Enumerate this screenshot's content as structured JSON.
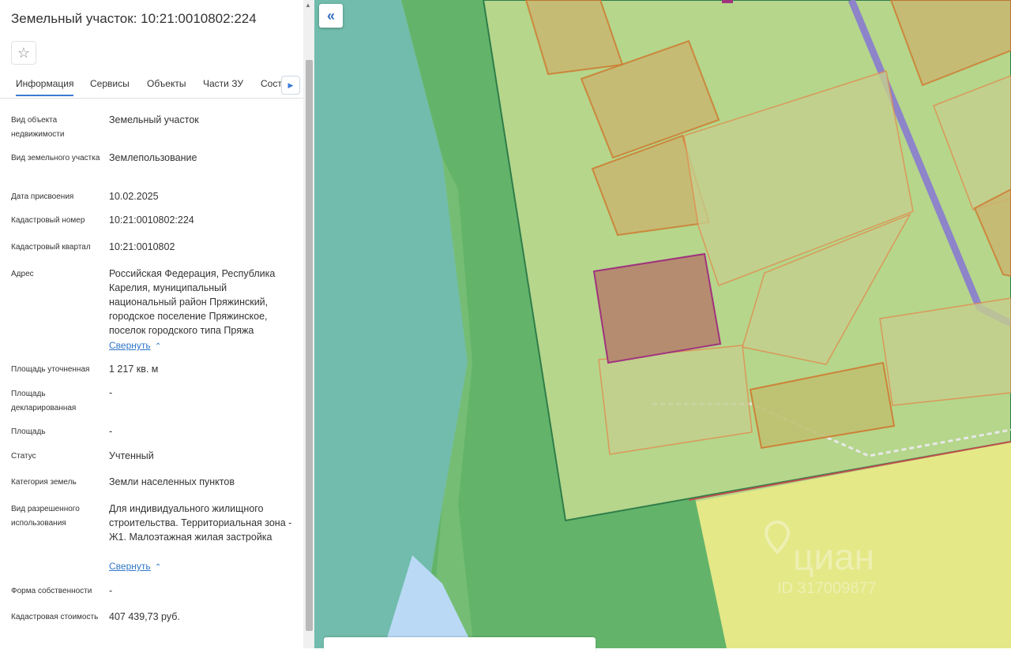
{
  "title": "Земельный участок: 10:21:0010802:224",
  "star_icon": "☆",
  "tabs": [
    "Информация",
    "Сервисы",
    "Объекты",
    "Части ЗУ",
    "Состав"
  ],
  "rows": [
    {
      "label": "Вид объекта недвижимости",
      "value": "Земельный участок"
    },
    {
      "label": "Вид земельного участка",
      "value": "Землепользование"
    },
    {
      "label": "Дата присвоения",
      "value": "10.02.2025"
    },
    {
      "label": "Кадастровый номер",
      "value": "10:21:0010802:224"
    },
    {
      "label": "Кадастровый квартал",
      "value": "10:21:0010802"
    },
    {
      "label": "Адрес",
      "value": "Российская Федерация, Республика Карелия, муниципальный национальный район Пряжинский, городское поселение Пряжинское, поселок городского типа Пряжа"
    },
    {
      "label": "Площадь уточненная",
      "value": "1 217 кв. м"
    },
    {
      "label": "Площадь декларированная",
      "value": "-"
    },
    {
      "label": "Площадь",
      "value": "-"
    },
    {
      "label": "Статус",
      "value": "Учтенный"
    },
    {
      "label": "Категория земель",
      "value": "Земли населенных пунктов"
    },
    {
      "label": "Вид разрешенного использования",
      "value": "Для индивидуального жилищного строительства. Территориальная зона - Ж1. Малоэтажная жилая застройка"
    },
    {
      "label": "Форма собственности",
      "value": "-"
    },
    {
      "label": "Кадастровая стоимость",
      "value": "407 439,73 руб."
    }
  ],
  "collapse_label": "Свернуть",
  "collapse_arrow": "⌃",
  "map_collapse_icon": "«",
  "tab_scroll_icon": "▶",
  "watermark_text": "циан",
  "watermark_id": "ID 317009877",
  "colors": {
    "water": "#6fb9a9",
    "forest": "#66b56a",
    "plot_zone": "#b4d58a",
    "residential": "#e6e98a",
    "selected_plot": "#b58d6e",
    "road": "#8f84c8"
  }
}
